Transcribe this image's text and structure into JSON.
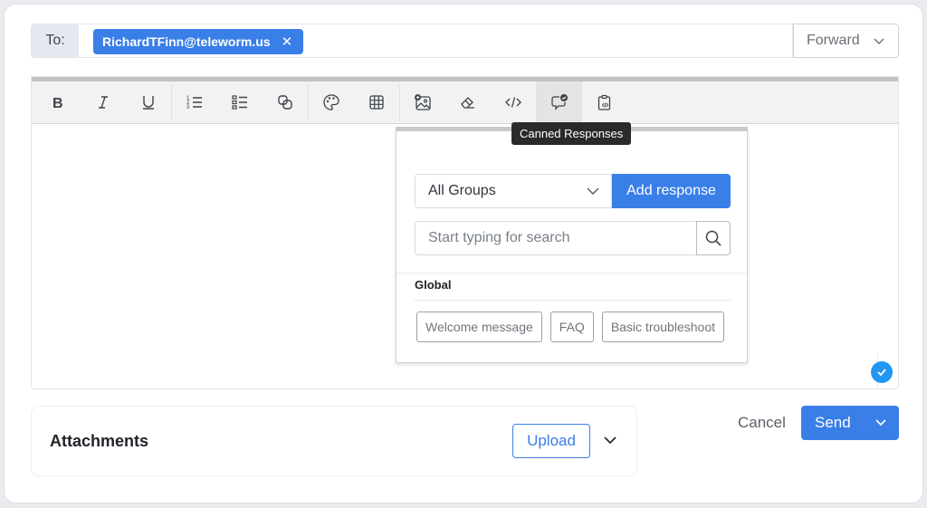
{
  "recipient": {
    "to_label": "To:",
    "chips": [
      {
        "email": "RichardTFinn@teleworm.us",
        "remove_icon": "close-icon"
      }
    ],
    "mode_select": {
      "value": "Forward"
    }
  },
  "toolbar": {
    "buttons": [
      {
        "name": "bold",
        "icon": "bold-icon"
      },
      {
        "name": "italic",
        "icon": "italic-icon"
      },
      {
        "name": "underline",
        "icon": "underline-icon"
      },
      {
        "name": "ordered-list",
        "icon": "ordered-list-icon"
      },
      {
        "name": "bullet-list",
        "icon": "bullet-list-icon"
      },
      {
        "name": "link",
        "icon": "link-icon"
      },
      {
        "name": "color",
        "icon": "palette-icon"
      },
      {
        "name": "table",
        "icon": "table-icon"
      },
      {
        "name": "insert-image",
        "icon": "image-add-icon"
      },
      {
        "name": "clear-format",
        "icon": "eraser-icon"
      },
      {
        "name": "code",
        "icon": "code-icon"
      },
      {
        "name": "canned-responses",
        "icon": "canned-response-icon",
        "active": true
      },
      {
        "name": "code-snippet",
        "icon": "clipboard-code-icon"
      }
    ],
    "tooltip": "Canned Responses"
  },
  "canned_popup": {
    "group_select": {
      "value": "All Groups"
    },
    "add_button": "Add response",
    "search": {
      "value": "",
      "placeholder": "Start typing for search"
    },
    "group_title": "Global",
    "responses": [
      "Welcome message",
      "FAQ",
      "Basic troubleshoot"
    ]
  },
  "attachments": {
    "title": "Attachments",
    "upload_label": "Upload"
  },
  "actions": {
    "cancel_label": "Cancel",
    "send_label": "Send"
  },
  "colors": {
    "accent": "#3a7ee8",
    "badge": "#2196f3"
  }
}
